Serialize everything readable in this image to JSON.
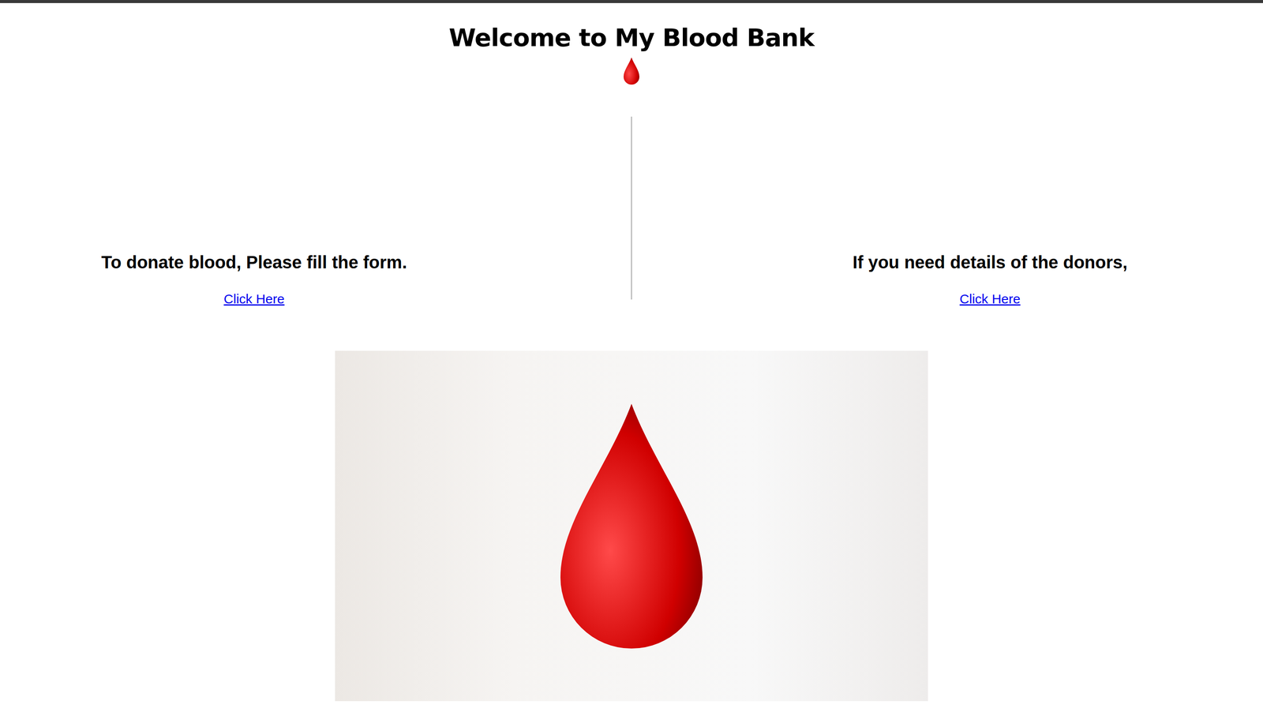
{
  "header": {
    "title": "Welcome to My Blood Bank"
  },
  "sections": [
    {
      "heading": "To donate blood, Please fill the form.",
      "link": "Click Here"
    },
    {
      "heading": "If you need details of the donors,",
      "link": "Click Here"
    }
  ]
}
